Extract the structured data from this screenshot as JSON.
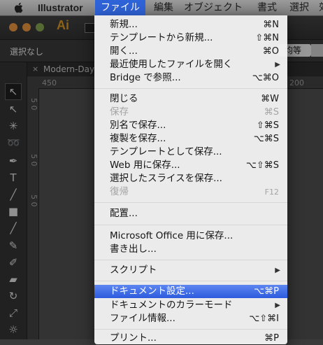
{
  "menubar": {
    "app_name": "Illustrator",
    "items": [
      {
        "label": "ファイル",
        "active": true
      },
      {
        "label": "編集"
      },
      {
        "label": "オブジェクト"
      },
      {
        "label": "書式"
      },
      {
        "label": "選択"
      },
      {
        "label": "効"
      }
    ]
  },
  "app": {
    "logo": "Ai",
    "control_bar_label": "選択なし",
    "control_dropdown": "均等",
    "document_tab": "Modern-Day",
    "ruler_h": [
      "450",
      "200"
    ],
    "ruler_v": [
      "5 0",
      "5 0",
      "5 0"
    ]
  },
  "file_menu": {
    "new": {
      "label": "新規...",
      "shortcut": "⌘N"
    },
    "new_from_template": {
      "label": "テンプレートから新規...",
      "shortcut": "⇧⌘N"
    },
    "open": {
      "label": "開く...",
      "shortcut": "⌘O"
    },
    "open_recent": {
      "label": "最近使用したファイルを開く"
    },
    "bridge": {
      "label": "Bridge で参照...",
      "shortcut": "⌥⌘O"
    },
    "close": {
      "label": "閉じる",
      "shortcut": "⌘W"
    },
    "save": {
      "label": "保存",
      "shortcut": "⌘S"
    },
    "save_as": {
      "label": "別名で保存...",
      "shortcut": "⇧⌘S"
    },
    "save_copy": {
      "label": "複製を保存...",
      "shortcut": "⌥⌘S"
    },
    "save_template": {
      "label": "テンプレートとして保存..."
    },
    "save_web": {
      "label": "Web 用に保存...",
      "shortcut": "⌥⇧⌘S"
    },
    "save_slices": {
      "label": "選択したスライスを保存..."
    },
    "revert": {
      "label": "復帰",
      "shortcut": "F12"
    },
    "place": {
      "label": "配置..."
    },
    "save_office": {
      "label": "Microsoft Office 用に保存..."
    },
    "export": {
      "label": "書き出し..."
    },
    "scripts": {
      "label": "スクリプト"
    },
    "document_setup": {
      "label": "ドキュメント設定...",
      "shortcut": "⌥⌘P"
    },
    "color_mode": {
      "label": "ドキュメントのカラーモード"
    },
    "file_info": {
      "label": "ファイル情報...",
      "shortcut": "⌥⇧⌘I"
    },
    "print": {
      "label": "プリント...",
      "shortcut": "⌘P"
    }
  },
  "colors": {
    "highlight": "#2c5bde",
    "menu_bg": "#f2f2f2"
  }
}
